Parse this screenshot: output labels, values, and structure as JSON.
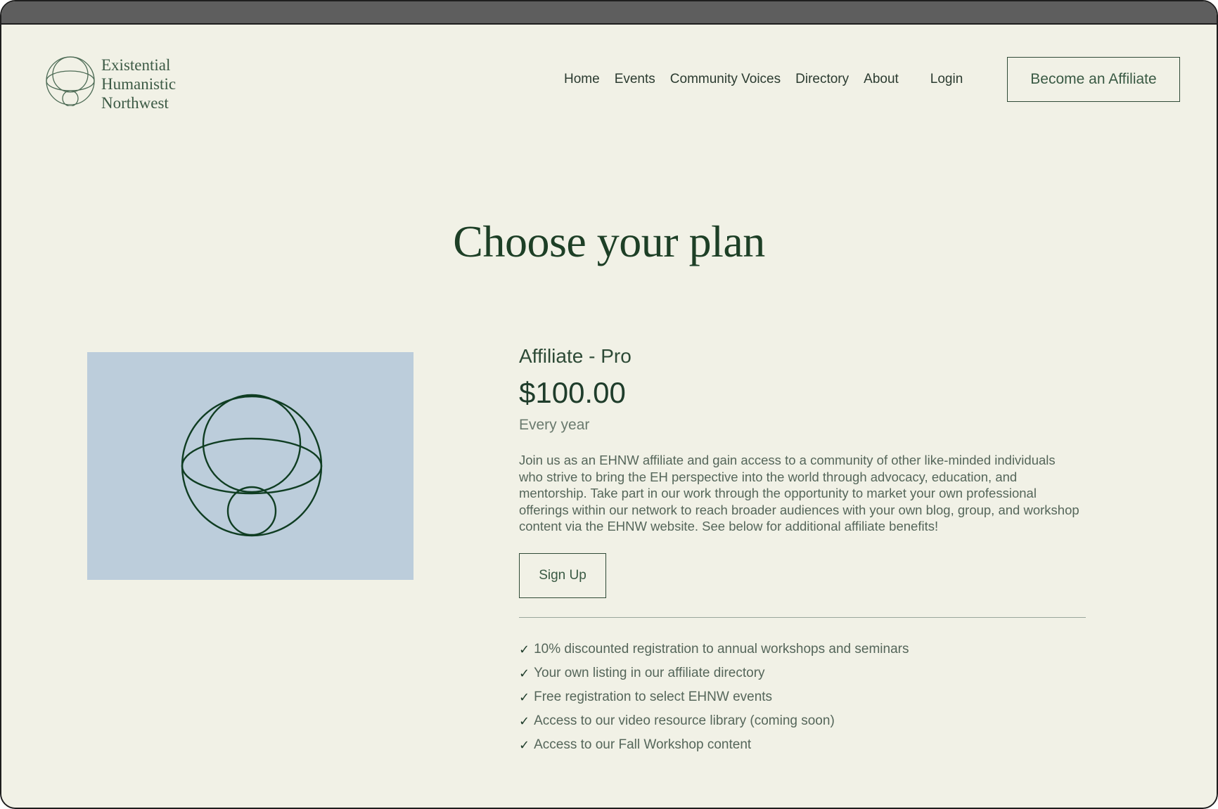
{
  "header": {
    "logo_lines": [
      "Existential",
      "Humanistic",
      "Northwest"
    ],
    "nav": [
      {
        "label": "Home"
      },
      {
        "label": "Events"
      },
      {
        "label": "Community Voices"
      },
      {
        "label": "Directory"
      },
      {
        "label": "About"
      }
    ],
    "login_label": "Login",
    "cta_label": "Become an Affiliate"
  },
  "main": {
    "title": "Choose your plan",
    "plan": {
      "name": "Affiliate - Pro",
      "price": "$100.00",
      "period": "Every year",
      "description": "Join us as an EHNW affiliate and gain access to a community of other like-minded individuals who strive to bring the EH perspective into the world through advocacy, education, and mentorship. Take part in our work through the opportunity to market your own professional offerings within our network to reach broader audiences with your own blog, group, and workshop content via the EHNW website. See below for additional affiliate benefits!",
      "signup_label": "Sign Up",
      "benefits": [
        "10% discounted registration to annual workshops and seminars",
        "Your own listing in our affiliate directory",
        "Free registration to select EHNW events",
        "Access to our video resource library (coming soon)",
        "Access to our Fall Workshop content"
      ],
      "check_glyph": "✓"
    }
  },
  "colors": {
    "background": "#f1f1e6",
    "brand_green": "#1d3f26",
    "image_bg": "#bccddb"
  }
}
